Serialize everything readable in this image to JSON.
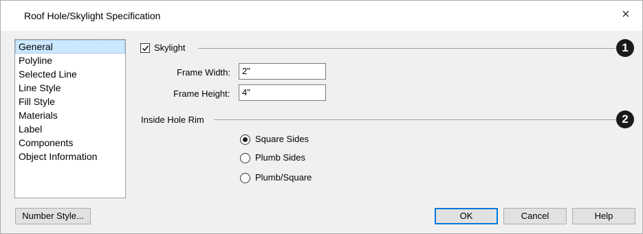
{
  "window": {
    "title": "Roof Hole/Skylight Specification",
    "close_glyph": "×"
  },
  "sidebar": {
    "items": [
      {
        "label": "General",
        "selected": true
      },
      {
        "label": "Polyline"
      },
      {
        "label": "Selected Line"
      },
      {
        "label": "Line Style"
      },
      {
        "label": "Fill Style"
      },
      {
        "label": "Materials"
      },
      {
        "label": "Label"
      },
      {
        "label": "Components"
      },
      {
        "label": "Object Information"
      }
    ]
  },
  "skylight": {
    "label": "Skylight",
    "checked": true,
    "marker": "1",
    "frame_width_label": "Frame Width:",
    "frame_width_value": "2\"",
    "frame_height_label": "Frame Height:",
    "frame_height_value": "4\""
  },
  "rim": {
    "label": "Inside Hole Rim",
    "marker": "2",
    "options": [
      {
        "label": "Square Sides",
        "selected": true
      },
      {
        "label": "Plumb Sides",
        "selected": false
      },
      {
        "label": "Plumb/Square",
        "selected": false
      }
    ]
  },
  "buttons": {
    "number_style": "Number Style...",
    "ok": "OK",
    "cancel": "Cancel",
    "help": "Help"
  },
  "colors": {
    "selection": "#cce8ff",
    "default_border": "#0078d7",
    "marker_fill": "#1a1a1a"
  }
}
